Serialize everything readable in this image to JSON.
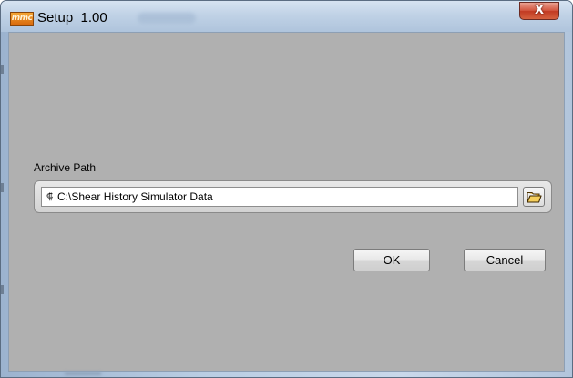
{
  "window": {
    "title": "Setup  1.00",
    "app_icon_text": "mmc",
    "close_label": "X"
  },
  "archive": {
    "label": "Archive Path",
    "path_value": "C:\\Shear History Simulator Data",
    "path_type_glyph": "⸿"
  },
  "buttons": {
    "ok_label": "OK",
    "cancel_label": "Cancel"
  },
  "icons": {
    "app": "app-logo-icon",
    "path_type": "path-type-icon",
    "browse": "folder-open-icon",
    "close": "close-icon"
  },
  "colors": {
    "client_background": "#b0b0b0",
    "close_button": "#c23a22",
    "title_bar": "#c0d2e6"
  }
}
